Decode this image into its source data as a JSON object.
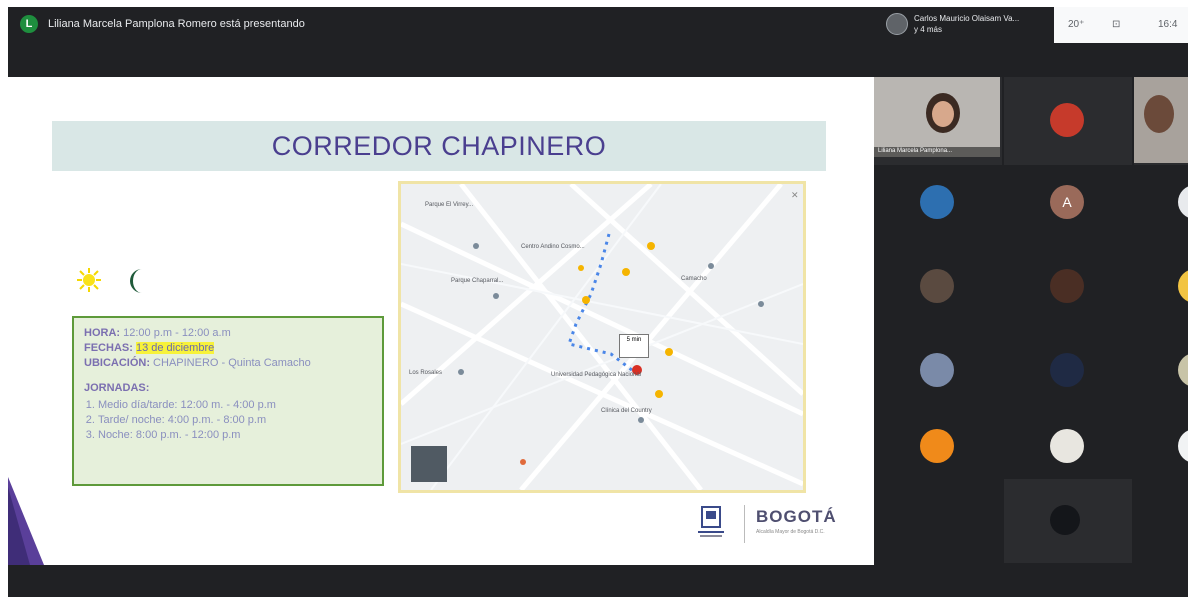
{
  "topbar": {
    "presenter_initial": "L",
    "presenter_text": "Liliana Marcela Pamplona Romero está presentando",
    "cast_name": "Carlos Mauricio Olaisam Va...",
    "cast_sub": "y 4 más",
    "right_items": [
      "20⁺",
      "⊡",
      "16:4"
    ]
  },
  "slide": {
    "title": "CORREDOR  CHAPINERO",
    "info": {
      "hora_key": "HORA:",
      "hora_val": " 12:00 p.m - 12:00 a.m",
      "fechas_key": "FECHAS:",
      "fechas_val": "13 de diciembre",
      "ubicacion_key": "UBICACIÓN:",
      "ubicacion_val": " CHAPINERO - Quinta Camacho",
      "jornadas_key": "JORNADAS:",
      "jornadas": [
        "Medio día/tarde: 12:00 m. - 4:00 p.m",
        "Tarde/ noche: 4:00 p.m. - 8:00 p.m",
        "Noche: 8:00 p.m. - 12:00 p.m"
      ]
    },
    "map_labels": [
      "Centro Andino Cosmo...",
      "Parque El Virrey...",
      "Parque Chaparral...",
      "Los Rosales",
      "Universidad Pedagógica Nacional",
      "Clínica del Country",
      "Camacho"
    ],
    "map_popup": "5 min",
    "logo_text": "BOGOTÁ",
    "logo_sub": "Alcaldía Mayor de Bogotá D.C."
  },
  "participants": {
    "self_name": "Liliana Marcela Pamplona..."
  },
  "avatar_letter": "A",
  "colors": {
    "title": "#4a3f8f",
    "box_border": "#5e9a3a",
    "highlight": "#f7f23a",
    "meet_bg": "#202124"
  }
}
